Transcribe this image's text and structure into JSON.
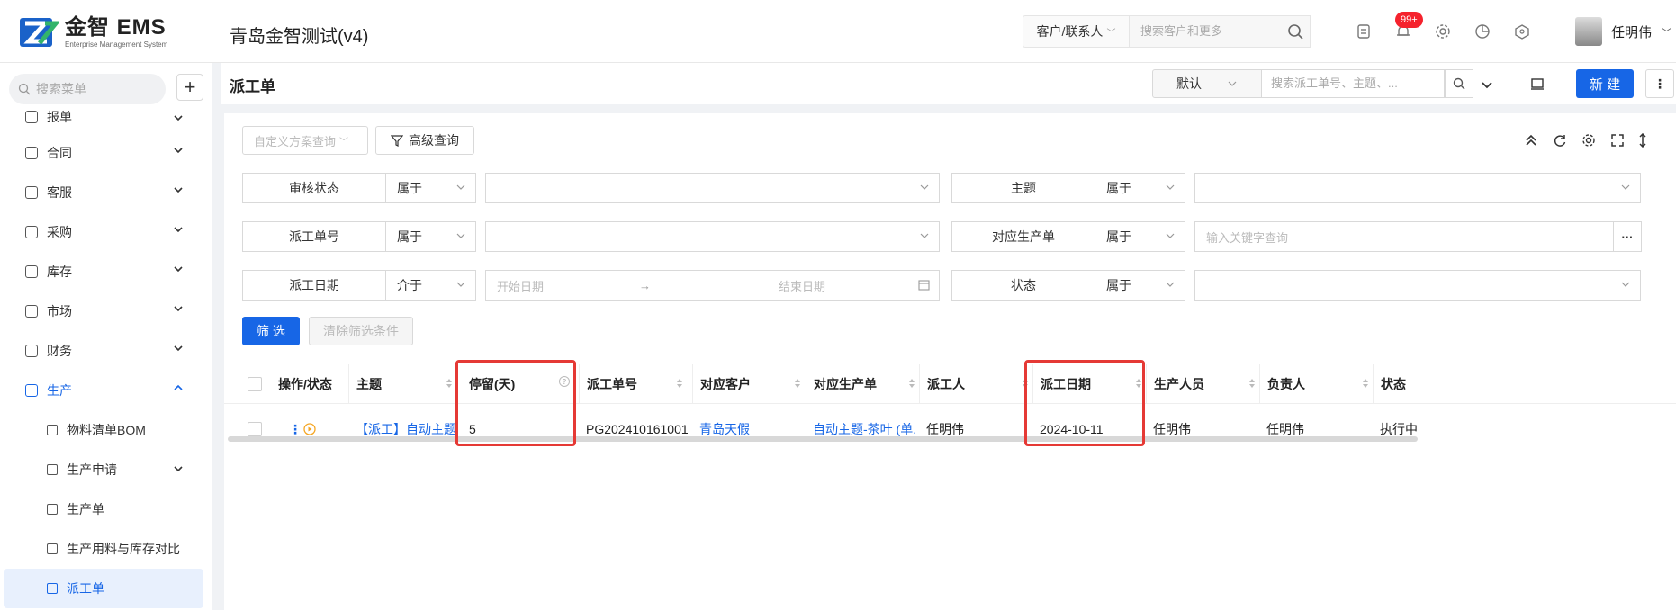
{
  "app": {
    "logo_name": "金智 EMS",
    "logo_sub": "Enterprise Management System",
    "company": "青岛金智测试(v4)"
  },
  "topbar": {
    "scope": "客户/联系人",
    "search_placeholder": "搜索客户和更多",
    "badge": "99+",
    "user": "任明伟"
  },
  "sidebar": {
    "search_placeholder": "搜索菜单",
    "items": [
      {
        "label": "报单",
        "icon": "chart-icon"
      },
      {
        "label": "合同",
        "icon": "contract-icon"
      },
      {
        "label": "客服",
        "icon": "headset-icon"
      },
      {
        "label": "采购",
        "icon": "cart-icon"
      },
      {
        "label": "库存",
        "icon": "warehouse-icon"
      },
      {
        "label": "市场",
        "icon": "flag-icon"
      },
      {
        "label": "财务",
        "icon": "finance-icon"
      },
      {
        "label": "生产",
        "icon": "factory-icon"
      }
    ],
    "subitems": [
      {
        "label": "物料清单BOM",
        "icon": "bom-icon"
      },
      {
        "label": "生产申请",
        "icon": "apply-icon"
      },
      {
        "label": "生产单",
        "icon": "order-icon"
      },
      {
        "label": "生产用料与库存对比",
        "icon": "compare-icon"
      },
      {
        "label": "派工单",
        "icon": "dispatch-icon"
      }
    ]
  },
  "page": {
    "title": "派工单",
    "view": "默认",
    "search_placeholder": "搜索派工单号、主题、...",
    "new_label": "新 建"
  },
  "filters": {
    "custom_query": "自定义方案查询",
    "advanced_query": "高级查询",
    "rows": [
      {
        "label": "审核状态",
        "op": "属于",
        "value": ""
      },
      {
        "label": "主题",
        "op": "属于",
        "value": ""
      },
      {
        "label": "派工单号",
        "op": "属于",
        "value": ""
      },
      {
        "label": "对应生产单",
        "op": "属于",
        "value": "输入关键字查询"
      },
      {
        "label": "派工日期",
        "op": "介于",
        "start": "开始日期",
        "end": "结束日期"
      },
      {
        "label": "状态",
        "op": "属于",
        "value": ""
      }
    ],
    "arrow": "→",
    "filter_btn": "筛 选",
    "clear_btn": "清除筛选条件"
  },
  "table": {
    "columns": [
      "操作/状态",
      "主题",
      "停留(天)",
      "派工单号",
      "对应客户",
      "对应生产单",
      "派工人",
      "派工日期",
      "生产人员",
      "负责人",
      "状态"
    ],
    "rows": [
      {
        "subject": "【派工】自动主题-...",
        "stay": "5",
        "number": "PG202410161001",
        "customer": "青岛天假",
        "production": "自动主题-茶叶 (单...",
        "dispatcher": "任明伟",
        "date": "2024-10-11",
        "worker": "任明伟",
        "owner": "任明伟",
        "status": "执行中"
      }
    ]
  },
  "colors": {
    "primary": "#1766e6",
    "highlight": "#e53935",
    "badge": "#f5222d"
  }
}
